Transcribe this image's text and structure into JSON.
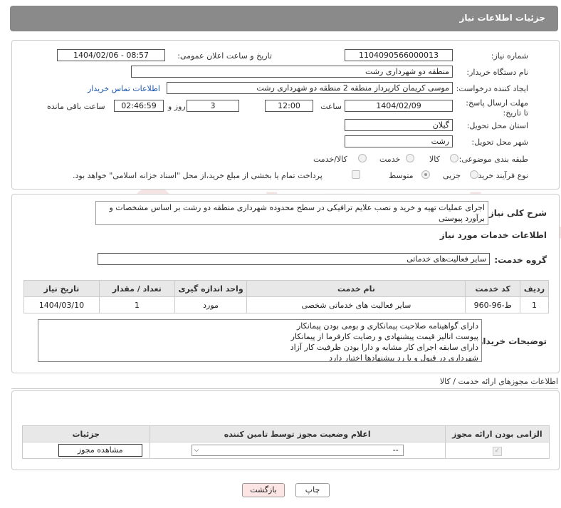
{
  "header": {
    "title": "جزئیات اطلاعات نیاز"
  },
  "watermark": {
    "text": "AriaTender.neT"
  },
  "form": {
    "need_number_label": "شماره نیاز:",
    "need_number": "1104090566000013",
    "announce_label": "تاریخ و ساعت اعلان عمومی:",
    "announce_value": "1404/02/06 - 08:57",
    "buyer_org_label": "نام دستگاه خریدار:",
    "buyer_org": "منطقه دو شهرداری رشت",
    "creator_label": "ایجاد کننده درخواست:",
    "creator": "موسی کریمان کارپرداز منطقه 2 منطقه دو شهرداری رشت",
    "contact_link": "اطلاعات تماس خریدار",
    "deadline_label": "مهلت ارسال پاسخ: تا تاریخ:",
    "deadline_date": "1404/02/09",
    "time_label": "ساعت",
    "deadline_time": "12:00",
    "days_value": "3",
    "days_label": "روز و",
    "remaining_time": "02:46:59",
    "remaining_label": "ساعت باقی مانده",
    "province_label": "استان محل تحویل:",
    "province": "گیلان",
    "city_label": "شهر محل تحویل:",
    "city": "رشت",
    "category_label": "طبقه بندی موضوعی:",
    "category_options": [
      "کالا",
      "خدمت",
      "کالا/خدمت"
    ],
    "process_label": "نوع فرآیند خرید :",
    "process_options": [
      "جزیی",
      "متوسط"
    ],
    "payment_note": "پرداخت تمام یا بخشی از مبلغ خرید،از محل \"اسناد خزانه اسلامی\" خواهد بود."
  },
  "summary": {
    "label": "شرح کلی نیاز:",
    "text": "اجرای عملیات تهیه و خرید و نصب علایم ترافیکی در سطح محدوده شهرداری منطقه دو رشت بر اساس مشخصات و برآورد پیوستی",
    "services_title": "اطلاعات خدمات مورد نیاز",
    "group_label": "گروه خدمت:",
    "group_value": "سایر فعالیت‌های خدماتی"
  },
  "services_table": {
    "headers": [
      "ردیف",
      "کد خدمت",
      "نام خدمت",
      "واحد اندازه گیری",
      "تعداد / مقدار",
      "تاریخ نیاز"
    ],
    "rows": [
      [
        "1",
        "ط-96-960",
        "سایر فعالیت های خدماتی شخصی",
        "مورد",
        "1",
        "1404/03/10"
      ]
    ]
  },
  "buyer_notes": {
    "label": "توضیحات خریدار:",
    "lines": [
      "دارای گواهینامه صلاحیت پیمانکاری و بومی بودن پیمانکار",
      "پیوست انالیز قیمت پیشنهادی و رضایت کارفرما از پیمانکار",
      "دارای سابقه اجرای کار مشابه و دارا بودن ظرفیت کار آزاد",
      "شهرداری در قبول و یا رد پیشنهادها اختیار دارد"
    ]
  },
  "permits": {
    "title": "اطلاعات مجوزهای ارائه خدمت / کالا",
    "headers": [
      "الزامی بودن ارائه مجوز",
      "اعلام وضعیت مجوز توسط تامین کننده",
      "جزئیات"
    ],
    "select_value": "--",
    "view_button": "مشاهده مجوز"
  },
  "footer": {
    "print_button": "چاپ",
    "back_button": "بازگشت"
  },
  "colors": {
    "header_bg": "#8a8a8a",
    "link": "#1a56b0",
    "back_btn_bg": "#fde5e5"
  }
}
